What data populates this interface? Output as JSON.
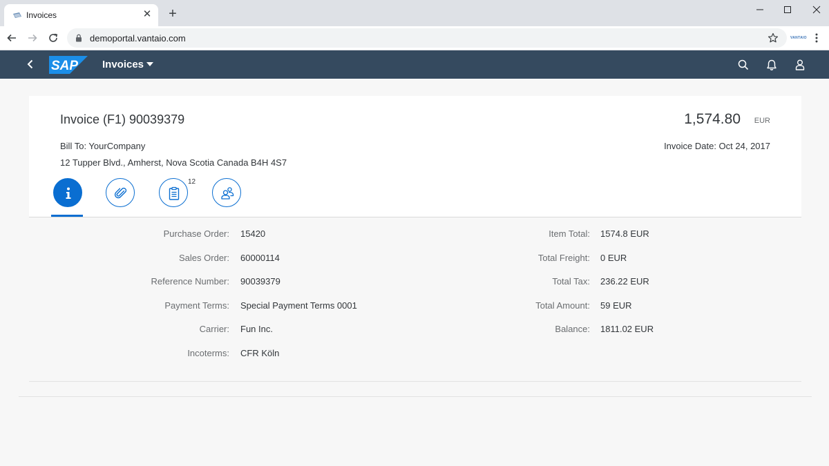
{
  "browser": {
    "tab_title": "Invoices",
    "new_tab_label": "+",
    "tab_close_label": "✕",
    "url": "demoportal.vantaio.com",
    "extension_label": "VANTAIO"
  },
  "shell": {
    "logo_text": "SAP",
    "app_title": "Invoices",
    "colors": {
      "shell_bg": "#354a5f",
      "accent": "#0a6ed1",
      "logo": "#1b8ee8"
    }
  },
  "header": {
    "title": "Invoice (F1) 90039379",
    "amount": "1,574.80",
    "currency": "EUR",
    "bill_to": "Bill To: YourCompany",
    "address": "12 Tupper Blvd., Amherst, Nova Scotia Canada B4H 4S7",
    "invoice_date": "Invoice Date: Oct 24, 2017"
  },
  "tabs": [
    {
      "icon": "info-icon",
      "selected": true
    },
    {
      "icon": "paperclip-icon",
      "selected": false
    },
    {
      "icon": "clipboard-icon",
      "selected": false,
      "count": "12"
    },
    {
      "icon": "people-icon",
      "selected": false
    }
  ],
  "details": {
    "left": [
      {
        "label": "Purchase Order:",
        "value": "15420"
      },
      {
        "label": "Sales Order:",
        "value": "60000114"
      },
      {
        "label": "Reference Number:",
        "value": "90039379"
      },
      {
        "label": "Payment Terms:",
        "value": "Special Payment Terms 0001"
      },
      {
        "label": "Carrier:",
        "value": "Fun Inc."
      },
      {
        "label": "Incoterms:",
        "value": "CFR Köln"
      }
    ],
    "right": [
      {
        "label": "Item Total:",
        "value": "1574.8 EUR"
      },
      {
        "label": "Total Freight:",
        "value": "0 EUR"
      },
      {
        "label": "Total Tax:",
        "value": "236.22 EUR"
      },
      {
        "label": "Total Amount:",
        "value": "59 EUR"
      },
      {
        "label": "Balance:",
        "value": "1811.02 EUR"
      }
    ]
  }
}
